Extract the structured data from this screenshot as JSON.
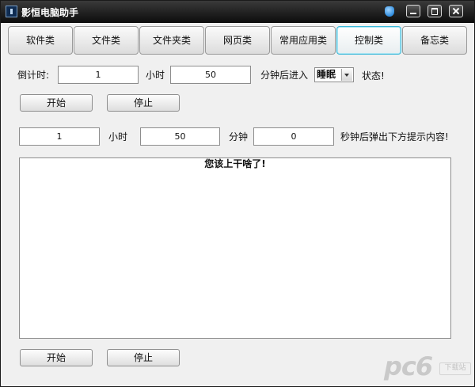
{
  "window": {
    "title": "影恒电脑助手"
  },
  "tabs": [
    {
      "label": "软件类",
      "active": false
    },
    {
      "label": "文件类",
      "active": false
    },
    {
      "label": "文件夹类",
      "active": false
    },
    {
      "label": "网页类",
      "active": false
    },
    {
      "label": "常用应用类",
      "active": false
    },
    {
      "label": "控制类",
      "active": true
    },
    {
      "label": "备忘类",
      "active": false
    }
  ],
  "countdown": {
    "label": "倒计时:",
    "hours_value": "1",
    "hours_unit": "小时",
    "minutes_value": "50",
    "minutes_suffix": "分钟后进入",
    "mode_selected": "睡眠",
    "state_suffix": "状态!",
    "start_label": "开始",
    "stop_label": "停止"
  },
  "reminder": {
    "hours_value": "1",
    "hours_unit": "小时",
    "minutes_value": "50",
    "minutes_unit": "分钟",
    "seconds_value": "0",
    "seconds_suffix": "秒钟后弹出下方提示内容!",
    "message": "您该上干啥了!",
    "start_label": "开始",
    "stop_label": "停止"
  },
  "watermark": {
    "logo": "pc6",
    "sub": "下载站"
  },
  "colors": {
    "titlebar": "#0c0c0c",
    "active_tab_border": "#38b8d8",
    "window_bg": "#f0f0f0"
  },
  "icons": {
    "app": "app-logo-icon",
    "skin": "skin-icon",
    "minimize": "minimize-icon",
    "maximize": "maximize-icon",
    "close": "close-icon",
    "dropdown": "chevron-down-icon"
  }
}
